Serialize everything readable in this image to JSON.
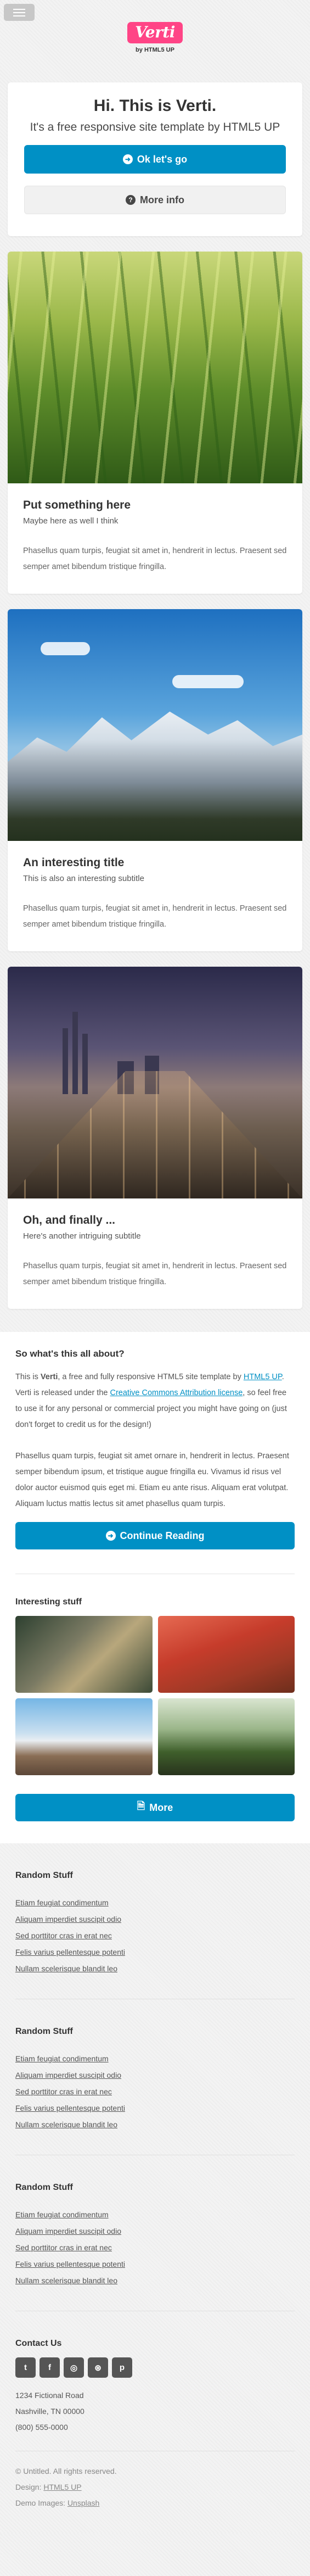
{
  "header": {
    "logo": "Verti",
    "byline": "by HTML5 UP"
  },
  "banner": {
    "title": "Hi. This is Verti.",
    "subtitle": "It's a free responsive site template by HTML5 UP",
    "primary_button": "Ok let's go",
    "secondary_button": "More info"
  },
  "features": [
    {
      "title": "Put something here",
      "subtitle": "Maybe here as well I think",
      "text": "Phasellus quam turpis, feugiat sit amet in, hendrerit in lectus. Praesent sed semper amet bibendum tristique fringilla."
    },
    {
      "title": "An interesting title",
      "subtitle": "This is also an interesting subtitle",
      "text": "Phasellus quam turpis, feugiat sit amet in, hendrerit in lectus. Praesent sed semper amet bibendum tristique fringilla."
    },
    {
      "title": "Oh, and finally ...",
      "subtitle": "Here's another intriguing subtitle",
      "text": "Phasellus quam turpis, feugiat sit amet in, hendrerit in lectus. Praesent sed semper amet bibendum tristique fringilla."
    }
  ],
  "about": {
    "title": "So what's this all about?",
    "p1_a": "This is ",
    "p1_b": "Verti",
    "p1_c": ", a free and fully responsive HTML5 site template by ",
    "p1_link": "HTML5 UP",
    "p1_d": ". Verti is released under the ",
    "p1_link2": "Creative Commons Attribution license",
    "p1_e": ", so feel free to use it for any personal or commercial project you might have going on (just don't forget to credit us for the design!)",
    "p2": "Phasellus quam turpis, feugiat sit amet ornare in, hendrerit in lectus. Praesent semper bibendum ipsum, et tristique augue fringilla eu. Vivamus id risus vel dolor auctor euismod quis eget mi. Etiam eu ante risus. Aliquam erat volutpat. Aliquam luctus mattis lectus sit amet phasellus quam turpis.",
    "continue_button": "Continue Reading",
    "interesting_title": "Interesting stuff",
    "more_button": "More"
  },
  "footer": {
    "sections": [
      {
        "title": "Random Stuff",
        "links": [
          "Etiam feugiat condimentum",
          "Aliquam imperdiet suscipit odio",
          "Sed porttitor cras in erat nec",
          "Felis varius pellentesque potenti",
          "Nullam scelerisque blandit leo"
        ]
      },
      {
        "title": "Random Stuff",
        "links": [
          "Etiam feugiat condimentum",
          "Aliquam imperdiet suscipit odio",
          "Sed porttitor cras in erat nec",
          "Felis varius pellentesque potenti",
          "Nullam scelerisque blandit leo"
        ]
      },
      {
        "title": "Random Stuff",
        "links": [
          "Etiam feugiat condimentum",
          "Aliquam imperdiet suscipit odio",
          "Sed porttitor cras in erat nec",
          "Felis varius pellentesque potenti",
          "Nullam scelerisque blandit leo"
        ]
      }
    ],
    "contact": {
      "title": "Contact Us",
      "social_icons": [
        "twitter-icon",
        "facebook-icon",
        "instagram-icon",
        "dribbble-icon",
        "pinterest-icon"
      ],
      "address_line1": "1234 Fictional Road",
      "address_line2": "Nashville, TN 00000",
      "phone": "(800) 555-0000"
    },
    "copyright": "© Untitled. All rights reserved.",
    "design_label": "Design: ",
    "design_link": "HTML5 UP",
    "images_label": "Demo Images: ",
    "images_link": "Unsplash"
  }
}
